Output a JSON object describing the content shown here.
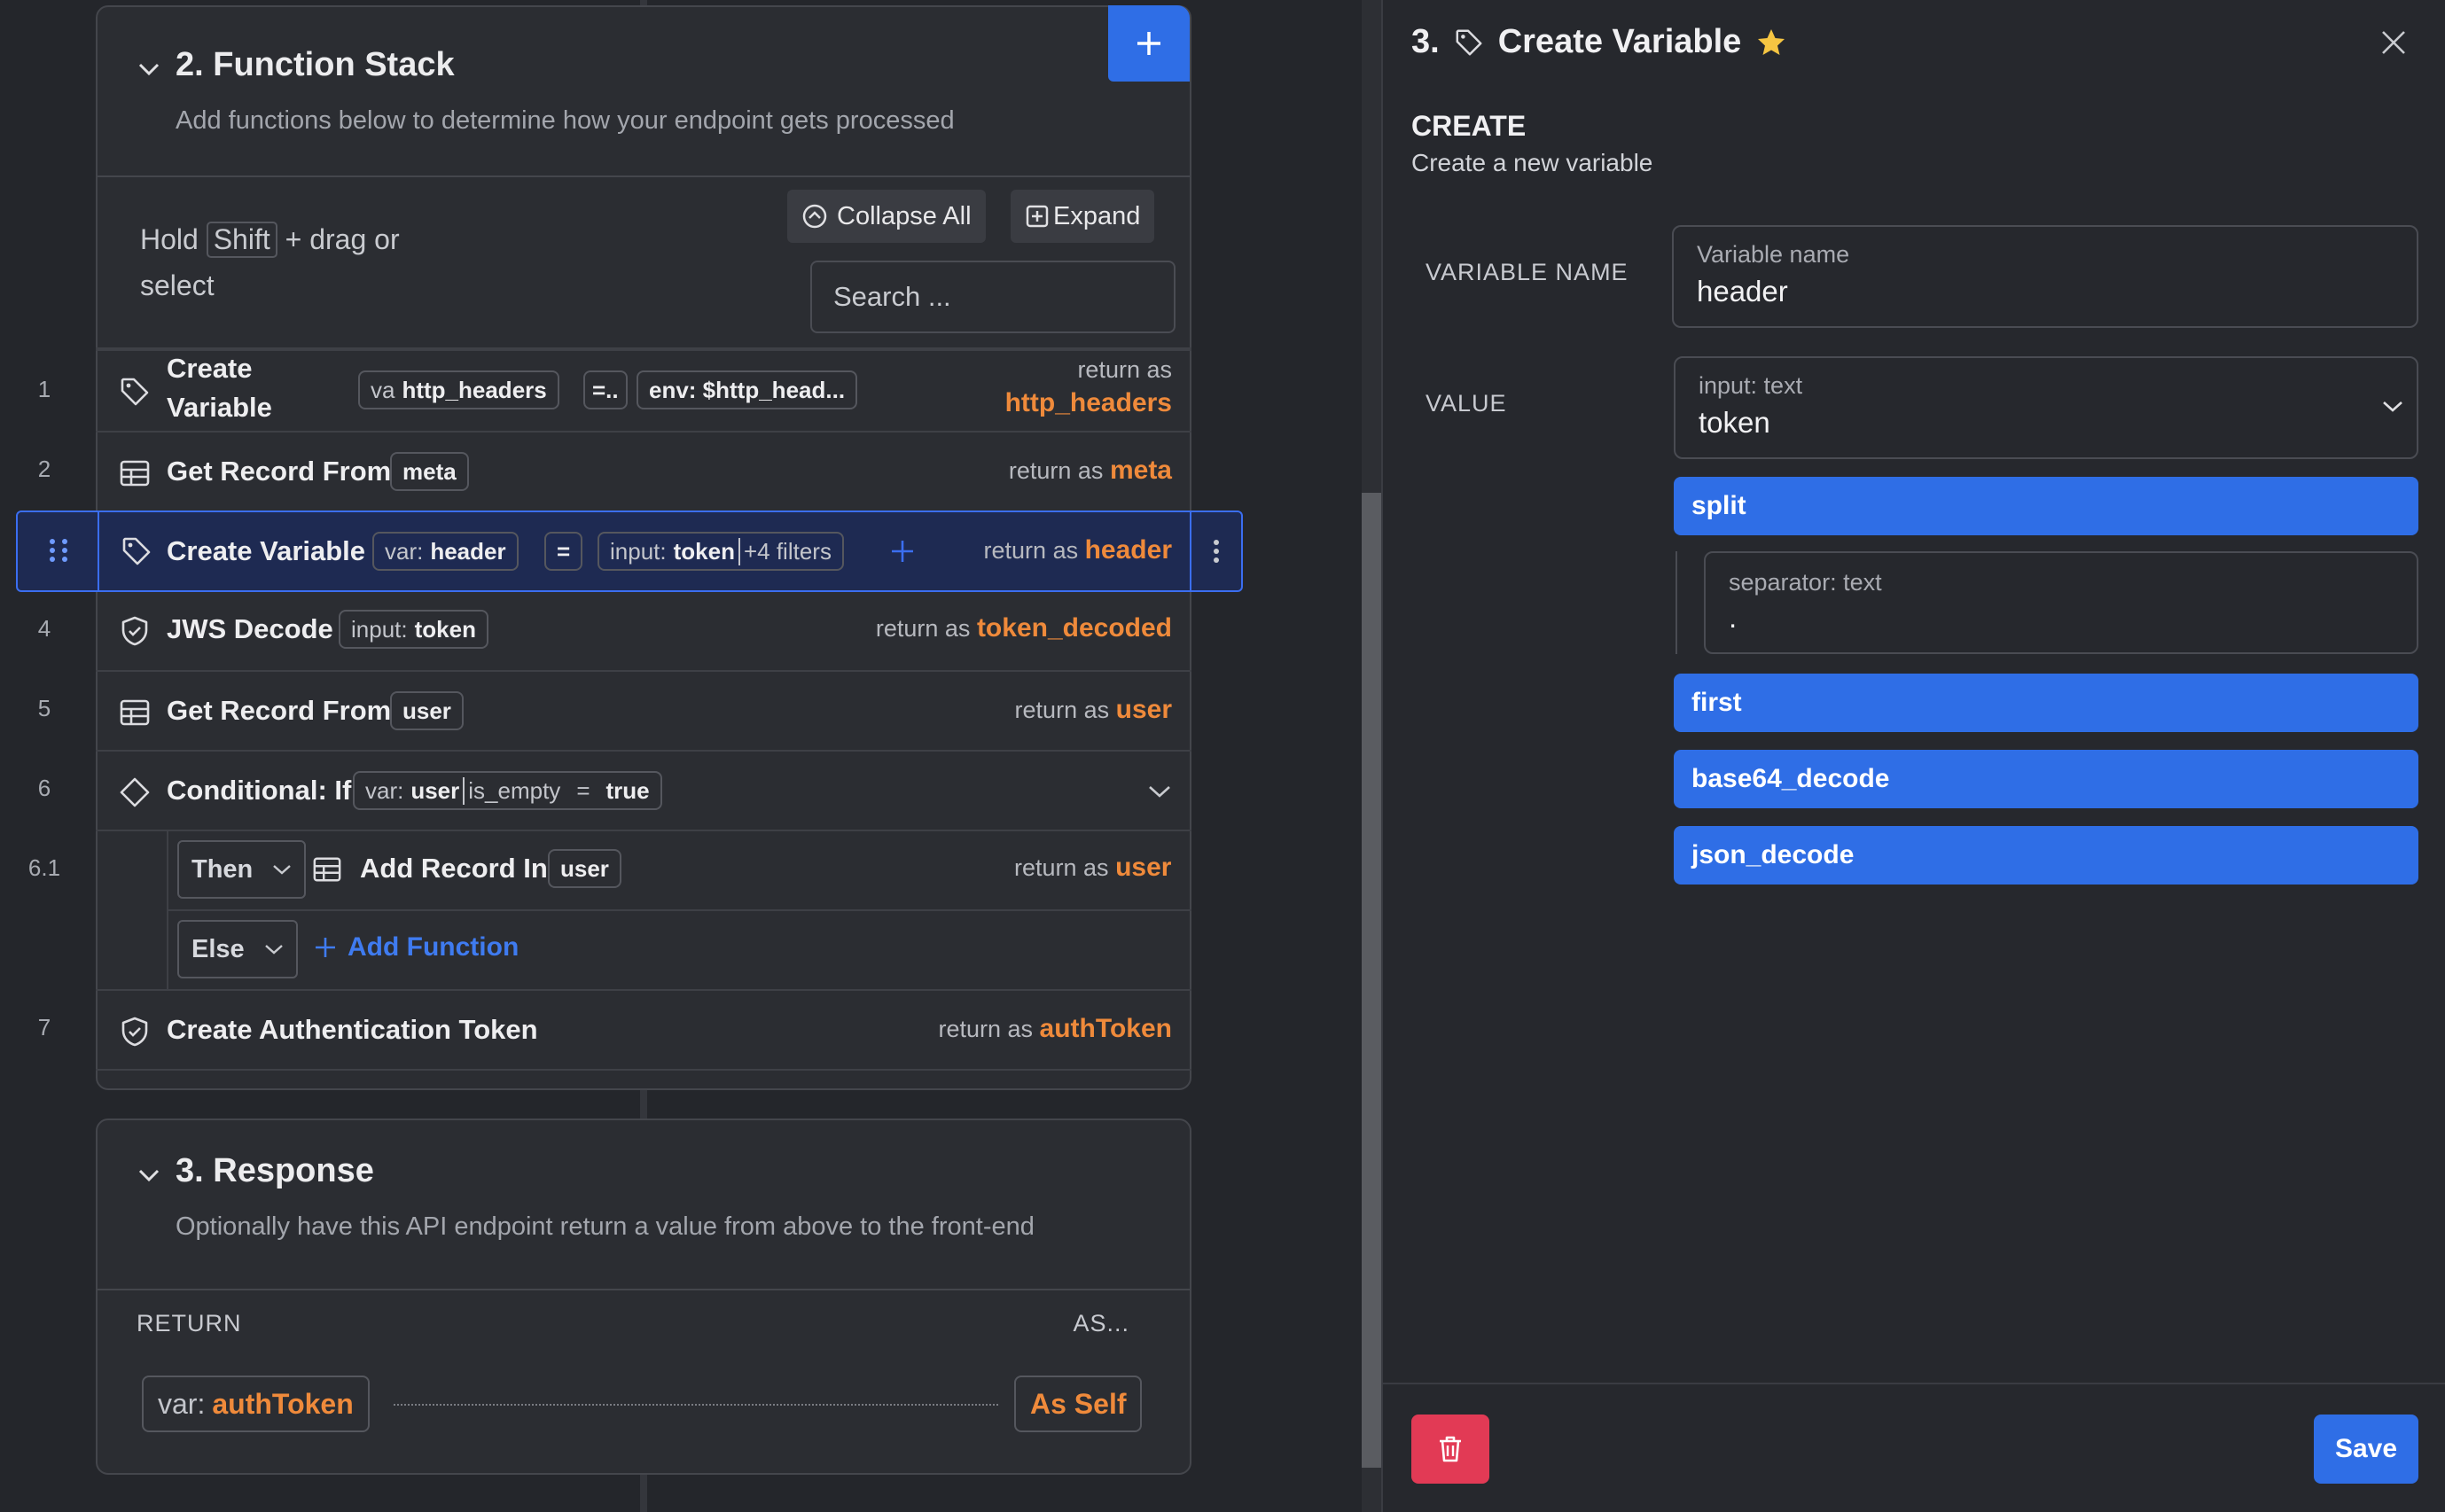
{
  "function_stack": {
    "title": "2. Function Stack",
    "subtitle": "Add functions below to determine how your endpoint gets processed",
    "hint_pre": "Hold",
    "hint_key": "Shift",
    "hint_post": "+ drag or",
    "hint_line2": "select",
    "collapse_all_label": "Collapse All",
    "expand_label": "Expand",
    "search_placeholder": "Search ...",
    "rows": [
      {
        "num": "1",
        "title_line1": "Create",
        "title_line2": "Variable",
        "pill1_pre": "va",
        "pill1_val": "http_headers",
        "op": "=..",
        "pill2": "env: $http_head...",
        "return_label": "return as",
        "return_var": "http_headers"
      },
      {
        "num": "2",
        "title": "Get Record From",
        "pill": "meta",
        "return_label": "return as",
        "return_var": "meta"
      },
      {
        "num": "3",
        "title": "Create Variable",
        "pill1_pre": "var:",
        "pill1_val": "header",
        "op": "=",
        "pill2_pre": "input:",
        "pill2_val": "token",
        "pill2_extra": "+4 filters",
        "return_label": "return as",
        "return_var": "header"
      },
      {
        "num": "4",
        "title": "JWS Decode",
        "pill_pre": "input:",
        "pill_val": "token",
        "return_label": "return as",
        "return_var": "token_decoded"
      },
      {
        "num": "5",
        "title": "Get Record From",
        "pill": "user",
        "return_label": "return as",
        "return_var": "user"
      },
      {
        "num": "6",
        "title": "Conditional: If",
        "cond_pre": "var:",
        "cond_var": "user",
        "cond_filter": "is_empty",
        "cond_op": "=",
        "cond_val": "true"
      },
      {
        "num": "6.1",
        "branch": "Then",
        "title": "Add Record In",
        "pill": "user",
        "return_label": "return as",
        "return_var": "user"
      },
      {
        "branch": "Else",
        "add_label": "Add Function"
      },
      {
        "num": "7",
        "title": "Create Authentication Token",
        "return_label": "return as",
        "return_var": "authToken"
      }
    ]
  },
  "response": {
    "title": "3. Response",
    "subtitle": "Optionally have this API endpoint return a value from above to the front-end",
    "col_return": "RETURN",
    "col_as": "AS...",
    "return_pre": "var:",
    "return_var": "authToken",
    "as_value": "As Self"
  },
  "panel": {
    "step": "3.",
    "title": "Create Variable",
    "section": "CREATE",
    "section_sub": "Create a new variable",
    "var_name_label": "VARIABLE NAME",
    "var_name_small": "Variable name",
    "var_name_value": "header",
    "value_label": "VALUE",
    "value_small": "input: text",
    "value_value": "token",
    "filters": [
      {
        "name": "split",
        "param_label": "separator: text",
        "param_value": "."
      },
      {
        "name": "first"
      },
      {
        "name": "base64_decode"
      },
      {
        "name": "json_decode"
      }
    ],
    "save_label": "Save"
  },
  "colors": {
    "accent": "#2f6ee6",
    "return_var": "#ef8a3b",
    "danger": "#e23a55",
    "star": "#f5c542"
  }
}
